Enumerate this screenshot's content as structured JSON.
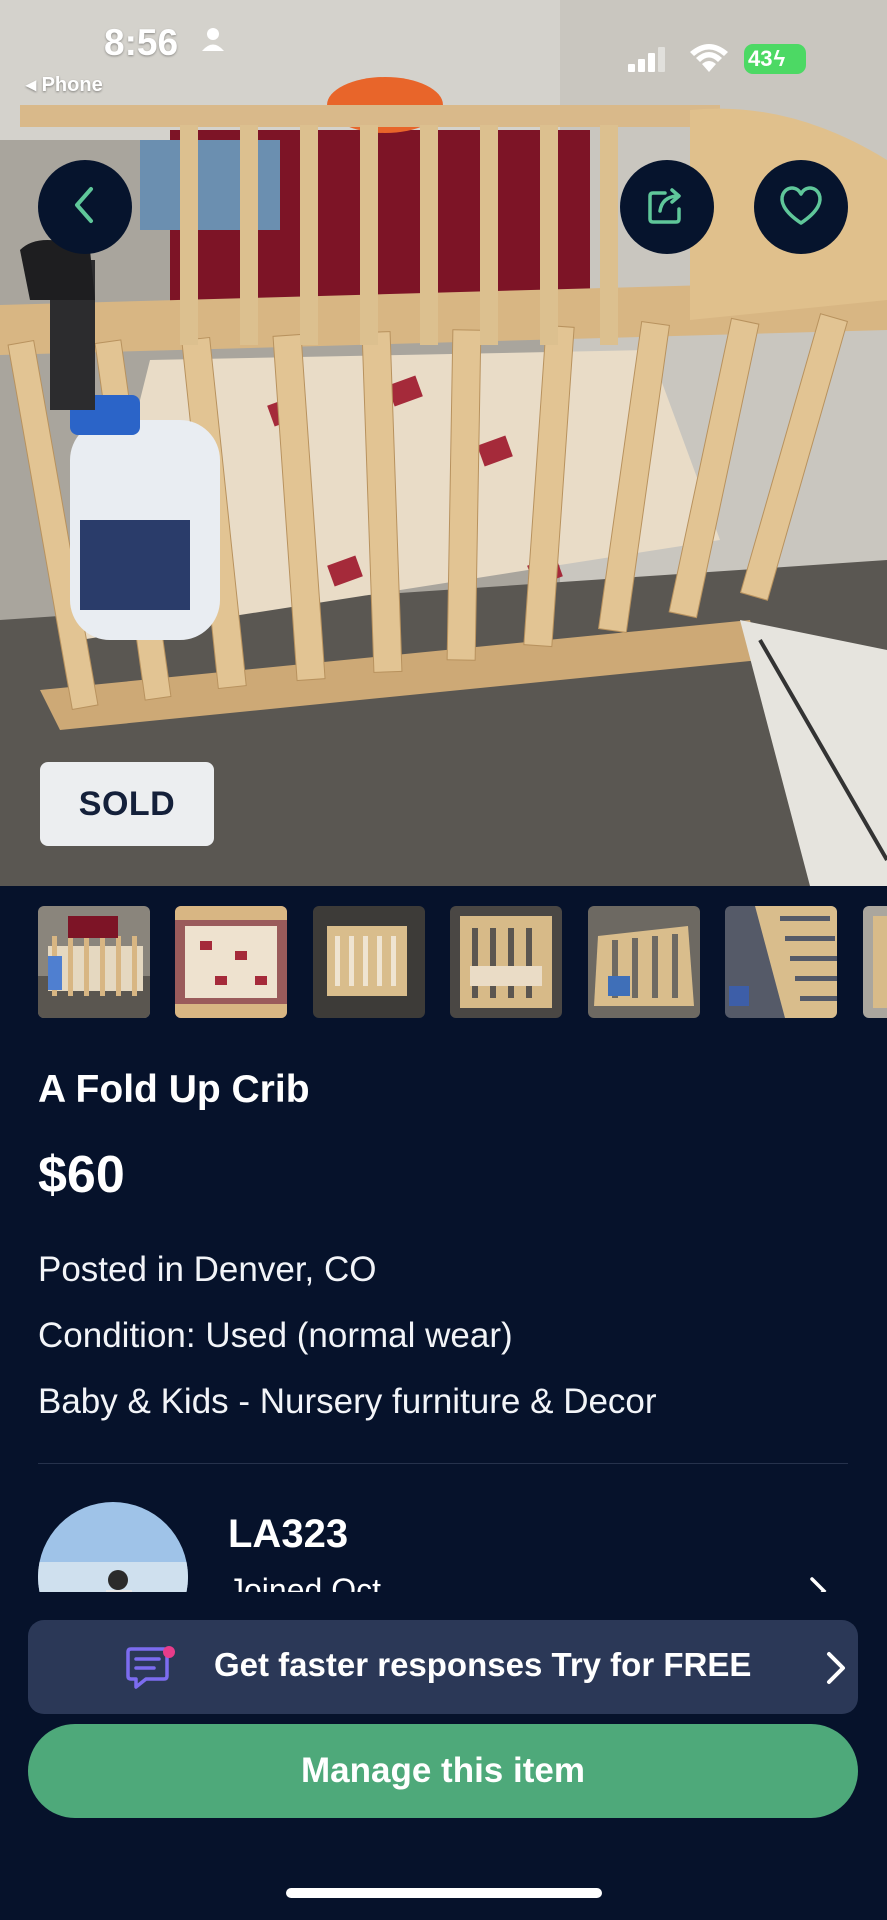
{
  "status_bar": {
    "time": "8:56",
    "back_app": "◂ Phone",
    "battery": "43"
  },
  "hero": {
    "sold_badge": "SOLD",
    "photo_subject": "crib-photo"
  },
  "icons": {
    "back": "chevron-left-icon",
    "share": "share-icon",
    "favorite": "heart-icon"
  },
  "thumbnails": [
    "thumb-1",
    "thumb-2",
    "thumb-3",
    "thumb-4",
    "thumb-5",
    "thumb-6",
    "thumb-7"
  ],
  "listing": {
    "title": "A Fold Up Crib",
    "price": "$60",
    "location": "Posted in Denver, CO",
    "condition": "Condition: Used (normal wear)",
    "category": "Baby & Kids - Nursery furniture & Decor"
  },
  "seller": {
    "name": "LA323",
    "joined": "Joined Oct"
  },
  "promo": {
    "text": "Get faster responses  Try for FREE"
  },
  "actions": {
    "manage_label": "Manage this item"
  },
  "colors": {
    "background": "#06122b",
    "promo_bg": "#2b3857",
    "manage_button": "#4ea97a",
    "accent_icon": "#5fc79a",
    "sold_badge_bg": "#eceef0"
  }
}
